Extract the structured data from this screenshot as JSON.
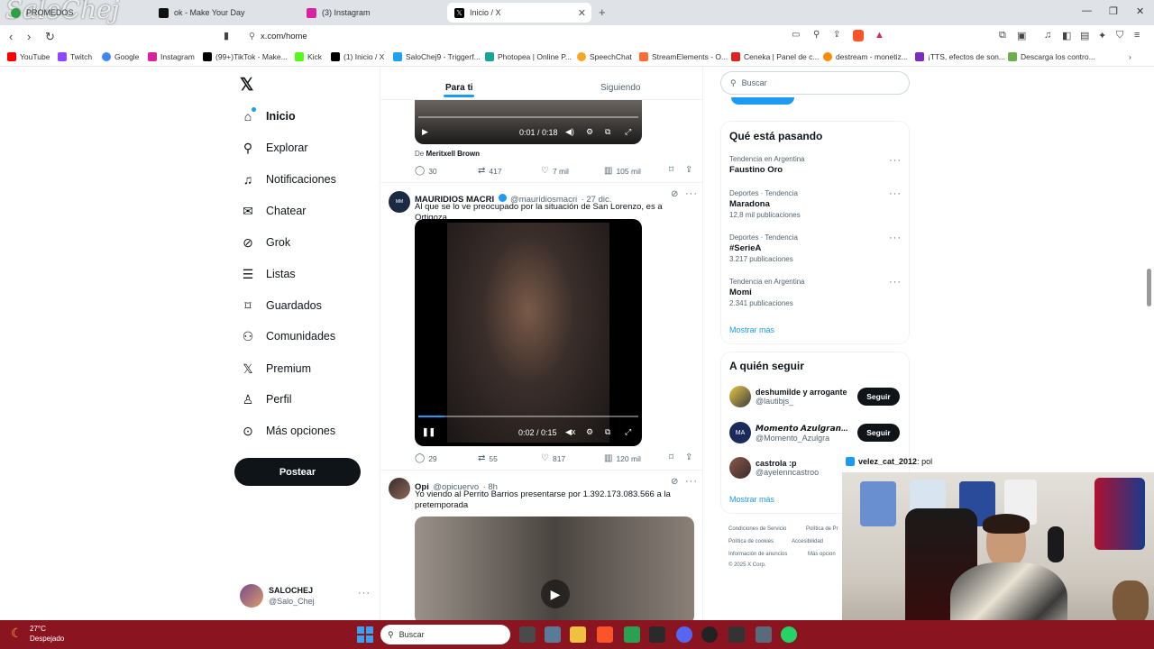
{
  "watermark": "SaloChej",
  "browser": {
    "tabs": [
      {
        "label": "PROMEDOS",
        "active": false
      },
      {
        "label": "ok - Make Your Day",
        "active": false
      },
      {
        "label": "(3) Instagram",
        "active": false
      },
      {
        "label": "Inicio / X",
        "active": true
      }
    ],
    "url": "x.com/home",
    "bookmarks": [
      "YouTube",
      "Twitch",
      "Google",
      "Instagram",
      "(99+)TikTok - Make...",
      "Kick",
      "(1) Inicio / X",
      "SaloChej9 - Triggerf...",
      "Photopea | Online P...",
      "SpeechChat",
      "StreamElements - O...",
      "Ceneka | Panel de c...",
      "destream - monetiz...",
      "¡TTS, efectos de son...",
      "Descarga los contro..."
    ]
  },
  "nav": {
    "items": [
      {
        "label": "Inicio",
        "icon": "home-icon"
      },
      {
        "label": "Explorar",
        "icon": "search-icon"
      },
      {
        "label": "Notificaciones",
        "icon": "bell-icon"
      },
      {
        "label": "Chatear",
        "icon": "mail-icon"
      },
      {
        "label": "Grok",
        "icon": "grok-icon"
      },
      {
        "label": "Listas",
        "icon": "list-icon"
      },
      {
        "label": "Guardados",
        "icon": "bookmark-icon"
      },
      {
        "label": "Comunidades",
        "icon": "people-icon"
      },
      {
        "label": "Premium",
        "icon": "x-logo-icon"
      },
      {
        "label": "Perfil",
        "icon": "person-icon"
      },
      {
        "label": "Más opciones",
        "icon": "more-circle-icon"
      }
    ],
    "post_label": "Postear",
    "account": {
      "name": "SALOCHEJ",
      "handle": "@Salo_Chej"
    }
  },
  "feed": {
    "tabs": [
      "Para ti",
      "Siguiendo"
    ],
    "tweet0": {
      "video_time": "0:01 / 0:18",
      "from_prefix": "De",
      "from_name": "Meritxell Brown",
      "replies": "30",
      "retweets": "417",
      "likes": "7 mil",
      "views": "105 mil"
    },
    "tweet1": {
      "name": "MAURIDIOS MACRI",
      "handle": "@mauridiosmacri",
      "date": "· 27 dic.",
      "text": "Al que se lo ve preocupado por la situación de San Lorenzo, es a Ortigoza.",
      "video_time": "0:02 / 0:15",
      "replies": "29",
      "retweets": "55",
      "likes": "817",
      "views": "120 mil"
    },
    "tweet2": {
      "name": "Opi",
      "handle": "@opicuervo",
      "date": "· 8h",
      "text": "Yo viendo al Perrito Barrios presentarse por 1.392.173.083.566 a la pretemporada"
    }
  },
  "sidebar": {
    "search_placeholder": "Buscar",
    "trends_title": "Qué está pasando",
    "trends": [
      {
        "context": "Tendencia en Argentina",
        "name": "Faustino Oro",
        "count": ""
      },
      {
        "context": "Deportes · Tendencia",
        "name": "Maradona",
        "count": "12,8 mil publicaciones"
      },
      {
        "context": "Deportes · Tendencia",
        "name": "#SerieA",
        "count": "3.217 publicaciones"
      },
      {
        "context": "Tendencia en Argentina",
        "name": "Momi",
        "count": "2.341 publicaciones"
      }
    ],
    "show_more": "Mostrar más",
    "follow_title": "A quién seguir",
    "follow": [
      {
        "name": "deshumilde y arrogante",
        "handle": "@lautibjs_"
      },
      {
        "name": "𝙈𝙤𝙢𝙚𝙣𝙩𝙤 𝘼𝙯𝙪𝙡𝙜𝙧𝙖𝙣...",
        "handle": "@Momento_Azulgra"
      },
      {
        "name": "castrola :p",
        "handle": "@ayelenncastroo"
      }
    ],
    "follow_label": "Seguir",
    "footer": [
      "Condiciones de Servicio",
      "Política de Pr",
      "Política de cookies",
      "Accesibilidad",
      "Información de anuncios",
      "Más opcion",
      "© 2025 X Corp."
    ]
  },
  "chat_overlay": {
    "user": "velez_cat_2012",
    "message": ": pol"
  },
  "taskbar": {
    "weather_temp": "27°C",
    "weather_desc": "Despejado",
    "search_placeholder": "Buscar"
  },
  "colors": {
    "accent": "#1d9bf0",
    "taskbar": "#8a1520",
    "text": "#0f1419",
    "muted": "#536471"
  }
}
